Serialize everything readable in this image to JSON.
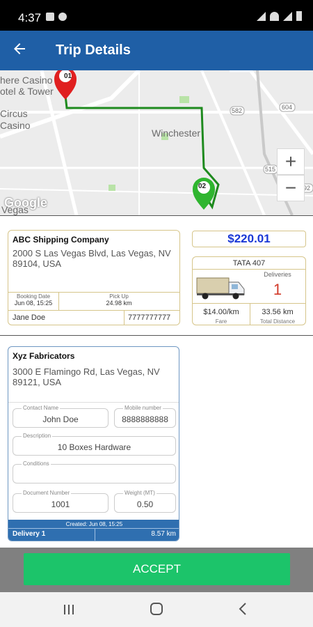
{
  "status_bar": {
    "time": "4:37"
  },
  "app_bar": {
    "title": "Trip Details",
    "back_icon": "arrow-left-icon"
  },
  "map": {
    "labels": {
      "casino_top": "here Casino",
      "hotel": "otel & Tower",
      "circus": "Circus",
      "casino": "Casino",
      "winchester": "Winchester",
      "vegas": "Vegas"
    },
    "road_shields": [
      "582",
      "604",
      "592",
      "515"
    ],
    "markers": [
      "01",
      "02"
    ],
    "zoom_in": "+",
    "zoom_out": "−",
    "attribution": "Google"
  },
  "pickup": {
    "company": "ABC Shipping Company",
    "address": "2000 S Las Vegas Blvd, Las Vegas, NV 89104, USA",
    "booking_date_label": "Booking Date",
    "booking_date": "Jun 08, 15:25",
    "pickup_label": "Pick Up",
    "pickup_distance": "24.98 km",
    "contact_name": "Jane Doe",
    "contact_phone": "7777777777"
  },
  "price": "$220.01",
  "vehicle": {
    "name": "TATA 407",
    "deliveries_label": "Deliveries",
    "deliveries": "1",
    "fare": "$14.00/km",
    "fare_label": "Fare",
    "total_distance": "33.56 km",
    "total_distance_label": "Total Distance"
  },
  "delivery": {
    "company": "Xyz Fabricators",
    "address": "3000 E Flamingo Rd, Las Vegas, NV 89121, USA",
    "contact_name_label": "Contact Name",
    "contact_name": "John Doe",
    "mobile_label": "Mobile number",
    "mobile": "8888888888",
    "description_label": "Description",
    "description": "10 Boxes Hardware",
    "conditions_label": "Conditions",
    "conditions": "",
    "document_label": "Document Number",
    "document": "1001",
    "weight_label": "Weight (MT)",
    "weight": "0.50",
    "created": "Created: Jun 08, 15:25",
    "delivery_label": "Delivery 1",
    "delivery_distance": "8.57 km"
  },
  "accept_label": "ACCEPT",
  "colors": {
    "app_bar": "#1f5fa6",
    "price": "#1a38d6",
    "accept": "#1cc46a",
    "deliveries_count": "#d23a2a"
  }
}
